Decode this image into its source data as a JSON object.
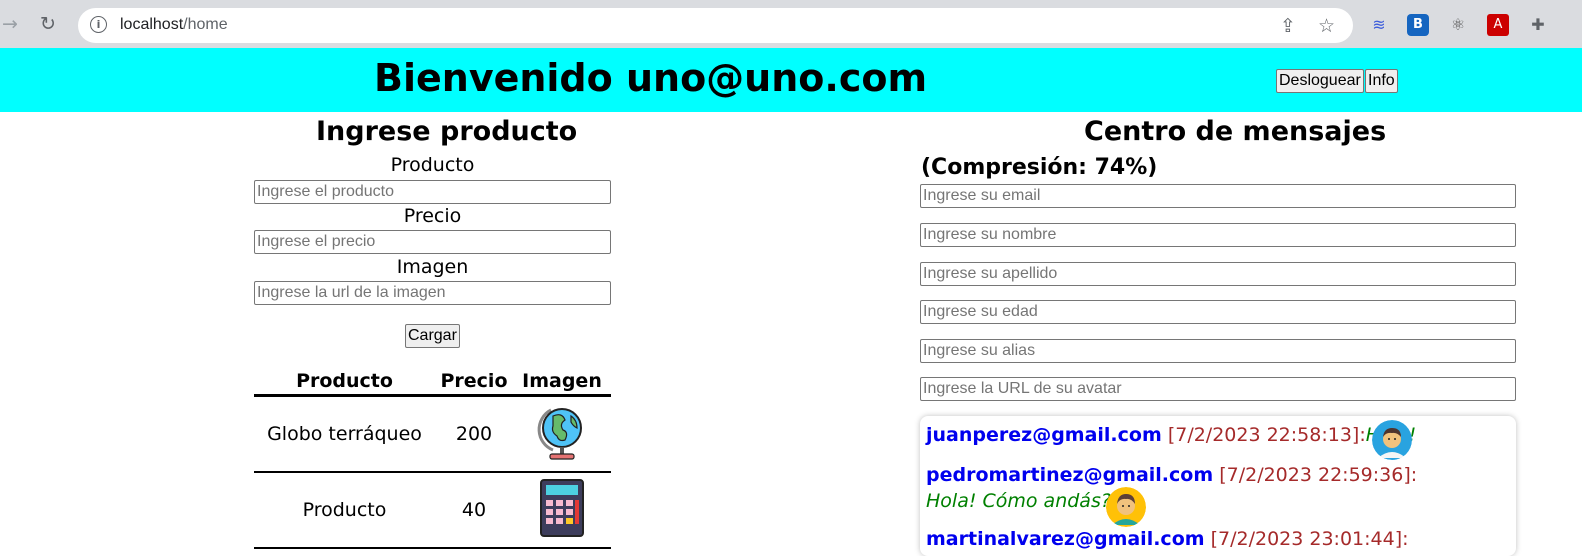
{
  "browser": {
    "url_host": "localhost",
    "url_path": "/home"
  },
  "header": {
    "welcome": "Bienvenido uno@uno.com",
    "logout_label": "Desloguear",
    "info_label": "Info",
    "bg_color": "#00ffff"
  },
  "product_form": {
    "title": "Ingrese producto",
    "product_label": "Producto",
    "product_placeholder": "Ingrese el producto",
    "price_label": "Precio",
    "price_placeholder": "Ingrese el precio",
    "image_label": "Imagen",
    "image_placeholder": "Ingrese la url de la imagen",
    "submit_label": "Cargar"
  },
  "products_table": {
    "headers": [
      "Producto",
      "Precio",
      "Imagen"
    ],
    "rows": [
      {
        "name": "Globo terráqueo",
        "price": "200",
        "icon": "globe-icon"
      },
      {
        "name": "Producto",
        "price": "40",
        "icon": "calculator-icon"
      }
    ]
  },
  "messages_center": {
    "title": "Centro de mensajes",
    "compression": "(Compresión: 74%)",
    "email_placeholder": "Ingrese su email",
    "name_placeholder": "Ingrese su nombre",
    "lastname_placeholder": "Ingrese su apellido",
    "age_placeholder": "Ingrese su edad",
    "alias_placeholder": "Ingrese su alias",
    "avatar_placeholder": "Ingrese la URL de su avatar",
    "messages": [
      {
        "email": "juanperez@gmail.com",
        "date": "[7/2/2023 22:58:13]:",
        "text": "Hola!",
        "avatar": "avatar-icon"
      },
      {
        "email": "pedromartinez@gmail.com",
        "date": "[7/2/2023 22:59:36]:",
        "text": "Hola! Cómo andás?",
        "avatar": "avatar-icon"
      },
      {
        "email": "martinalvarez@gmail.com",
        "date": "[7/2/2023 23:01:44]:",
        "text": "",
        "avatar": ""
      }
    ]
  },
  "colors": {
    "email": "#0000ee",
    "date": "#a52a2a",
    "text": "#008000"
  }
}
